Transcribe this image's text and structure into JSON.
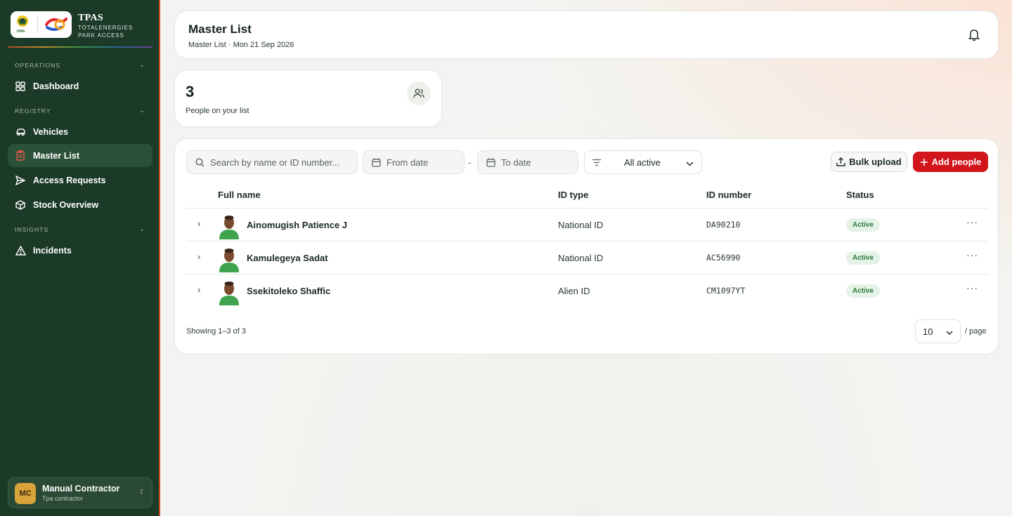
{
  "app": {
    "title": "TPAS",
    "subtitle_line1": "TOTALENERGIES",
    "subtitle_line2": "PARK ACCESS",
    "logo_text": "UWA"
  },
  "sidebar": {
    "sections": [
      {
        "label": "OPERATIONS"
      },
      {
        "label": "REGISTRY"
      },
      {
        "label": "INSIGHTS"
      }
    ],
    "items": [
      {
        "label": "Dashboard",
        "icon": "grid-icon"
      },
      {
        "label": "Vehicles",
        "icon": "car-icon"
      },
      {
        "label": "Master List",
        "icon": "clipboard-icon",
        "active": true
      },
      {
        "label": "Access Requests",
        "icon": "send-icon"
      },
      {
        "label": "Stock Overview",
        "icon": "package-icon"
      },
      {
        "label": "Incidents",
        "icon": "alert-triangle-icon"
      }
    ],
    "user": {
      "initials": "MC",
      "name": "Manual Contractor",
      "role": "Tpa contractor"
    }
  },
  "header": {
    "title": "Master List",
    "subtitle": "Master List · Mon 21 Sep 2026"
  },
  "stats": {
    "count": "3",
    "label": "People on your list"
  },
  "toolbar": {
    "search_placeholder": "Search by name or ID number...",
    "from_date": "From date",
    "date_separator": "-",
    "to_date": "To date",
    "filter_value": "All active",
    "bulk_upload": "Bulk upload",
    "add_people": "Add people"
  },
  "table": {
    "columns": [
      "Full name",
      "ID type",
      "ID number",
      "Status"
    ],
    "rows": [
      {
        "name": "Ainomugish Patience J",
        "id_type": "National ID",
        "id_number": "DA90210",
        "status": "Active"
      },
      {
        "name": "Kamulegeya Sadat",
        "id_type": "National ID",
        "id_number": "AC56990",
        "status": "Active"
      },
      {
        "name": "Ssekitoleko Shaffic",
        "id_type": "Alien ID",
        "id_number": "CM1097YT",
        "status": "Active"
      }
    ],
    "showing": "Showing 1–3 of 3",
    "page_size": "10",
    "per_page_label": "/ page"
  },
  "colors": {
    "sidebar_bg": "#1c3a28",
    "primary_red": "#d1151b",
    "status_green": "#2a7a3c"
  }
}
